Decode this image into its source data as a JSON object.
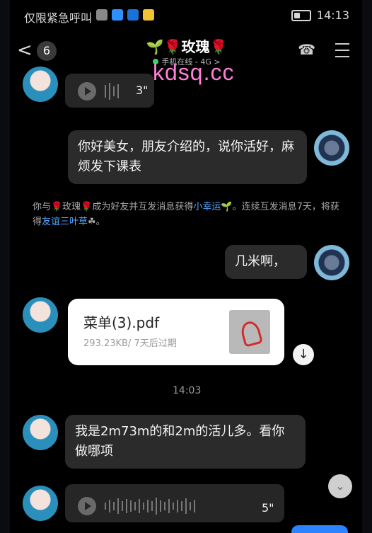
{
  "status": {
    "carrier": "仅限紧急呼叫",
    "time": "14:13"
  },
  "header": {
    "back": "<",
    "unread": "6",
    "title": "🌱🌹玫瑰🌹",
    "subtitle": "手机在线 - 4G >",
    "phone_icon": "phone-icon",
    "menu_icon": "menu-icon"
  },
  "watermark": "kdsq.cc",
  "messages": {
    "voice1_duration": "3\"",
    "msg1": "你好美女，朋友介绍的，说你活好，麻烦发下课表",
    "system_prefix": "你与🌹玫瑰🌹成为好友并互发消息获得",
    "system_link1": "小幸运",
    "system_mid": "🌱。连续互发消息7天，将获得",
    "system_link2": "友谊三叶草",
    "system_suffix": "☘。",
    "msg2": "几米啊，",
    "file_name": "菜单(3).pdf",
    "file_meta": "293.23KB/ 7天后过期",
    "time": "14:03",
    "msg3": "我是2m73m的和2m的活儿多。看你做哪项",
    "voice2_duration": "5\""
  },
  "colors": {
    "bg": "#000000",
    "bubble": "#2b2b2b",
    "link": "#4ea8ff",
    "accent": "#2b83ff"
  }
}
